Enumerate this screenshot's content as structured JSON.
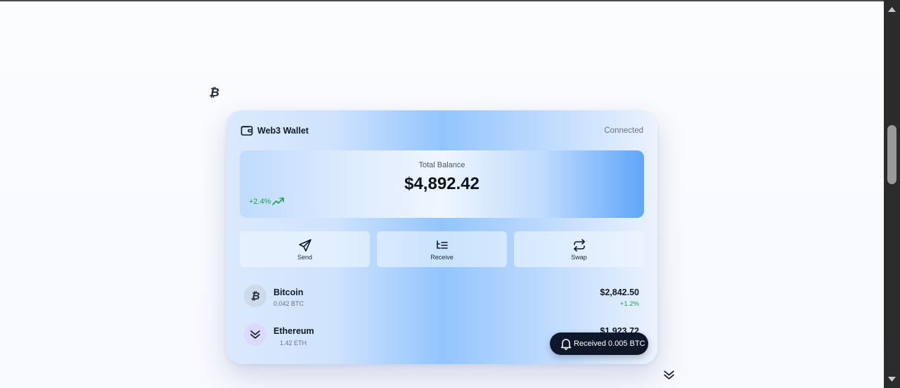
{
  "decor": {
    "btc_glyph": "₿"
  },
  "wallet": {
    "title": "Web3 Wallet",
    "status": "Connected",
    "icon": "wallet-icon"
  },
  "balance": {
    "label": "Total Balance",
    "value": "$4,892.42",
    "change": "+2.4%",
    "change_icon": "trending-up-icon"
  },
  "actions": [
    {
      "label": "Send",
      "icon": "send-icon"
    },
    {
      "label": "Receive",
      "icon": "receive-icon"
    },
    {
      "label": "Swap",
      "icon": "swap-icon"
    }
  ],
  "assets": [
    {
      "name": "Bitcoin",
      "amount": "0.042 BTC",
      "value": "$2,842.50",
      "change": "+1.2%",
      "glyph": "₿"
    },
    {
      "name": "Ethereum",
      "amount": "1.42 ETH",
      "value": "$1,923.72",
      "change": "",
      "icon": "ethereum-icon"
    }
  ],
  "toast": {
    "text": "Received 0.005 BTC",
    "icon": "bell-icon"
  },
  "colors": {
    "accent": "#60a5fa",
    "positive": "#16a34a",
    "toast_bg": "#0f172a",
    "scrollbar_bg": "#2b2b2b",
    "scroll_thumb": "#9a9a9a"
  }
}
